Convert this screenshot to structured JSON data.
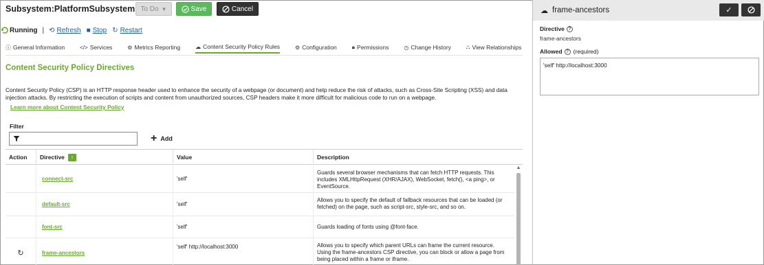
{
  "header": {
    "title": "Subsystem:PlatformSubsystem",
    "todo_label": "To Do",
    "save_label": "Save",
    "cancel_label": "Cancel"
  },
  "status": {
    "state": "Running",
    "separator": "|",
    "refresh": "Refresh",
    "stop": "Stop",
    "restart": "Restart"
  },
  "tabs": [
    {
      "label": "General Information",
      "icon": "info-icon"
    },
    {
      "label": "Services",
      "icon": "code-icon"
    },
    {
      "label": "Metrics Reporting",
      "icon": "gear-icon"
    },
    {
      "label": "Content Security Policy Rules",
      "icon": "cloud-icon",
      "active": true
    },
    {
      "label": "Configuration",
      "icon": "gear-icon"
    },
    {
      "label": "Permissions",
      "icon": "lock-icon"
    },
    {
      "label": "Change History",
      "icon": "clock-icon"
    },
    {
      "label": "View Relationships",
      "icon": "tree-icon"
    }
  ],
  "section": {
    "title": "Content Security Policy Directives",
    "description": "Content Security Policy (CSP) is an HTTP response header used to enhance the security of a webpage (or document) and help reduce the risk of attacks, such as Cross-Site Scripting (XSS) and data injection attacks. By restricting the execution of scripts and content from unauthorized sources, CSP headers make it more difficult for malicious code to run on a webpage.",
    "learn_more": "Learn more about Content Security Policy"
  },
  "filter": {
    "label": "Filter",
    "placeholder": "",
    "add_label": "Add"
  },
  "table": {
    "columns": [
      "Action",
      "Directive",
      "Value",
      "Description"
    ],
    "rows": [
      {
        "directive": "connect-src",
        "value": "'self'",
        "description": "Guards several browser mechanisms that can fetch HTTP requests. This includes XMLHttpRequest (XHR/AJAX), WebSocket, fetch(), <a ping>, or EventSource.",
        "action": ""
      },
      {
        "directive": "default-src",
        "value": "'self'",
        "description": "Allows you to specify the default of fallback resources that can be loaded (or fetched) on the page, such as script-src, style-src, and so on.",
        "action": ""
      },
      {
        "directive": "font-src",
        "value": "'self'",
        "description": "Guards loading of fonts using @font-face.",
        "action": ""
      },
      {
        "directive": "frame-ancestors",
        "value": "'self' http://localhost:3000",
        "description": "Allows you to specify which parent URLs can frame the current resource. Using the frame-ancestors CSP directive, you can block or allow a page from being placed within a frame or iframe.",
        "action": "refresh-icon"
      }
    ]
  },
  "panel": {
    "title": "frame-ancestors",
    "directive_label": "Directive",
    "directive_value": "frame-ancestors",
    "allowed_label": "Allowed",
    "required": "(required)",
    "allowed_value": "'self' http://localhost:3000"
  },
  "colors": {
    "accent_green": "#6aa832",
    "save_green": "#5cb85c",
    "dark_button": "#333333",
    "link_blue": "#1f5f9a"
  }
}
